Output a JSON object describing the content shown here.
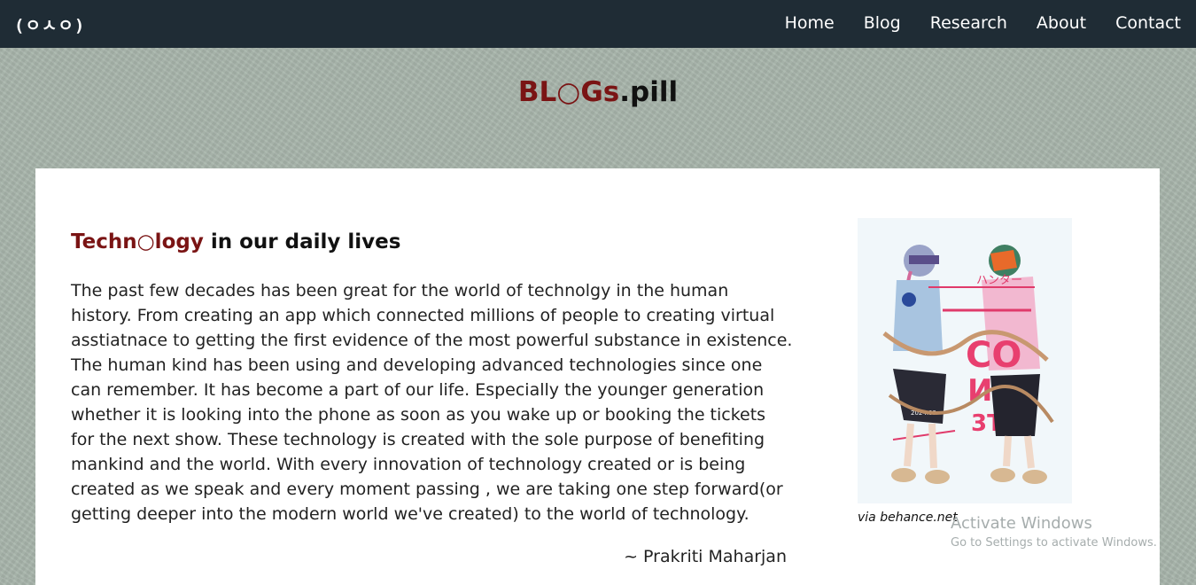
{
  "nav": {
    "logo": "(ㅇㅅㅇ)",
    "links": [
      "Home",
      "Blog",
      "Research",
      "About",
      "Contact"
    ]
  },
  "site_title": {
    "accent": "BL○Gs",
    "rest": ".pill"
  },
  "article": {
    "title_accent": "Techn○logy",
    "title_rest": " in our daily lives",
    "body": "The past few decades has been great for the world of technolgy in the human history. From creating an app which connected millions of people to creating virtual asstiatnace to getting the first evidence of the most powerful substance in existence. The human kind has been using and developing advanced technologies since one can remember. It has become a part of our life. Especially the younger generation whether it is looking into the phone as soon as you wake up or booking the tickets for the next show. These technology is created with the sole purpose of benefiting mankind and the world. With every innovation of technology created or is being created as we speak and every moment passing , we are taking one step forward(or getting deeper into the modern world we've created) to the world of technology.",
    "author": "~ Prakriti Maharjan"
  },
  "figure": {
    "caption": "via behance.net",
    "poster_text_1": "ハンター",
    "poster_text_2": "CO",
    "poster_text_3": "ИИ",
    "poster_text_4": "3T",
    "poster_small": "2024.09"
  },
  "watermark": {
    "title": "Activate Windows",
    "subtitle": "Go to Settings to activate Windows."
  },
  "colors": {
    "navbar": "#1f2c35",
    "accent": "#7a1414",
    "page_bg": "#a7b4aa"
  }
}
